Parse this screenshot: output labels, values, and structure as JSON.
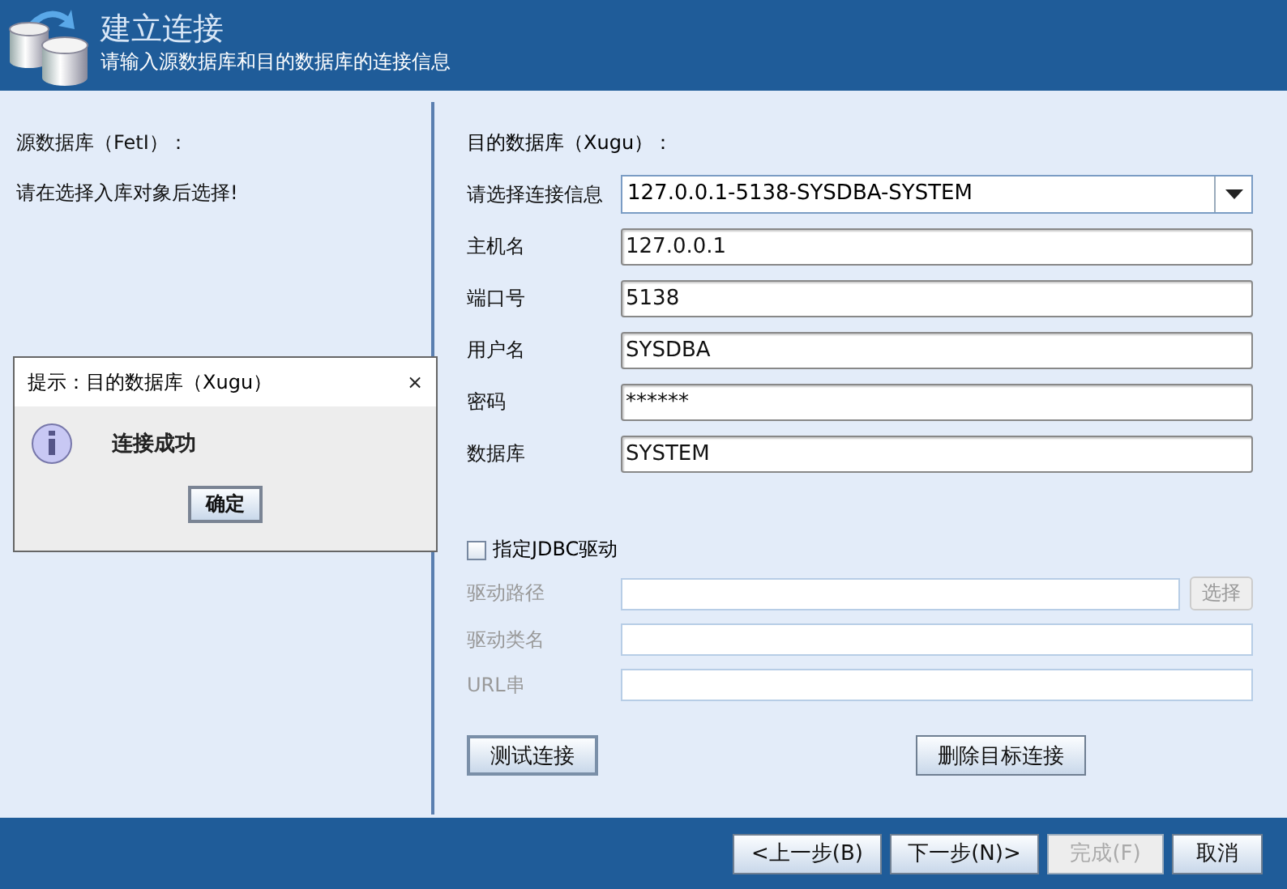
{
  "header": {
    "title": "建立连接",
    "subtitle": "请输入源数据库和目的数据库的连接信息"
  },
  "source": {
    "heading": "源数据库（FetI）：",
    "message": "请在选择入库对象后选择!"
  },
  "target": {
    "heading": "目的数据库（Xugu）：",
    "connection_label": "请选择连接信息",
    "connection_value": "127.0.0.1-5138-SYSDBA-SYSTEM",
    "fields": [
      {
        "label": "主机名",
        "value": "127.0.0.1"
      },
      {
        "label": "端口号",
        "value": "5138"
      },
      {
        "label": "用户名",
        "value": "SYSDBA"
      },
      {
        "label": "密码",
        "value": "******"
      },
      {
        "label": "数据库",
        "value": "SYSTEM"
      }
    ],
    "jdbc": {
      "label": "指定JDBC驱动",
      "checked": false
    },
    "jdbc_fields": [
      {
        "label": "驱动路径",
        "disabled": true,
        "button": "选择"
      },
      {
        "label": "驱动类名",
        "disabled": true
      },
      {
        "label": "URL串",
        "disabled": true
      }
    ],
    "test_button": "测试连接",
    "delete_button": "删除目标连接"
  },
  "dialog": {
    "title": "提示：目的数据库（Xugu）",
    "close": "×",
    "message": "连接成功",
    "ok": "确定"
  },
  "footer": {
    "buttons": [
      {
        "label": "<上一步(B)",
        "disabled": false
      },
      {
        "label": "下一步(N)>",
        "disabled": false
      },
      {
        "label": "完成(F)",
        "disabled": true
      },
      {
        "label": "取消",
        "disabled": false
      }
    ]
  }
}
